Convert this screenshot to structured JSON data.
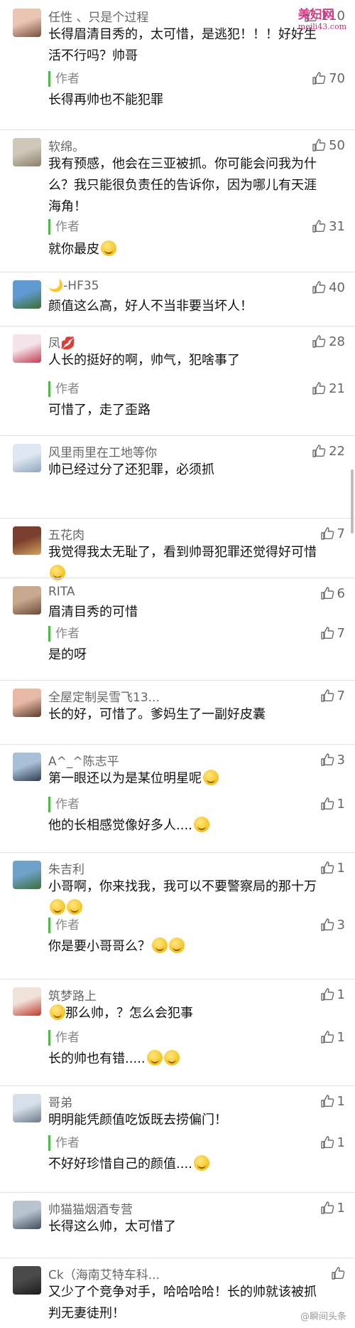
{
  "watermark": {
    "site_cn": "美妇网",
    "site_url": "meili43.com",
    "weibo": "@瞬间头条"
  },
  "comments": [
    {
      "name": "任性 、只是个过程",
      "likes": "110",
      "text": "长得眉清目秀的，太可惜，是逃犯！！！好好生活不行吗？帅哥",
      "reply": {
        "label": "作者",
        "likes": "70",
        "text": "长得再帅也不能犯罪"
      }
    },
    {
      "name": "软绵。",
      "likes": "50",
      "text": "我有预感，他会在三亚被抓。你可能会问我为什么？我只能很负责任的告诉你，因为哪儿有天涯海角！",
      "reply": {
        "label": "作者",
        "likes": "31",
        "text": "就你最皮"
      }
    },
    {
      "name": "🌙-HF35",
      "likes": "40",
      "text": "颜值这么高，好人不当非要当坏人！"
    },
    {
      "name": "凤💋",
      "likes": "28",
      "text": "人长的挺好的啊，帅气，犯啥事了",
      "reply": {
        "label": "作者",
        "likes": "21",
        "text": "可惜了，走了歪路"
      }
    },
    {
      "name": "风里雨里在工地等你",
      "likes": "22",
      "text": "帅已经过分了还犯罪，必须抓"
    },
    {
      "name": "五花肉",
      "likes": "7",
      "text": "我觉得我太无耻了，看到帅哥犯罪还觉得好可惜"
    },
    {
      "name": "RITA",
      "likes": "6",
      "text": "眉清目秀的可惜",
      "reply": {
        "label": "作者",
        "likes": "7",
        "text": "是的呀"
      }
    },
    {
      "name": "全屋定制吴雪飞13...",
      "likes": "7",
      "text": "长的好，可惜了。爹妈生了一副好皮囊"
    },
    {
      "name": "A^_^陈志平",
      "likes": "3",
      "text": "第一眼还以为是某位明星呢",
      "reply": {
        "label": "作者",
        "likes": "1",
        "text": "他的长相感觉像好多人...."
      }
    },
    {
      "name": "朱吉利",
      "likes": "1",
      "text": "小哥啊，你来找我，我可以不要警察局的那十万",
      "reply": {
        "label": "作者",
        "likes": "3",
        "text": "你是要小哥哥么？"
      }
    },
    {
      "name": "筑梦路上",
      "likes": "1",
      "text": "那么帅，？怎么会犯事",
      "reply": {
        "label": "作者",
        "likes": "1",
        "text": "长的帅也有错....."
      }
    },
    {
      "name": "哥弟",
      "likes": "1",
      "text": "明明能凭颜值吃饭既去捞偏门！",
      "reply": {
        "label": "作者",
        "likes": "1",
        "text": "不好好珍惜自己的颜值...."
      }
    },
    {
      "name": "帅猫猫烟酒专营",
      "likes": "1",
      "text": "长得这么帅，太可惜了"
    },
    {
      "name": "Ck（海南艾特车科...",
      "likes": "",
      "text": "又少了个竞争对手，哈哈哈哈！长的帅就该被抓判无妻徒刑！"
    }
  ]
}
